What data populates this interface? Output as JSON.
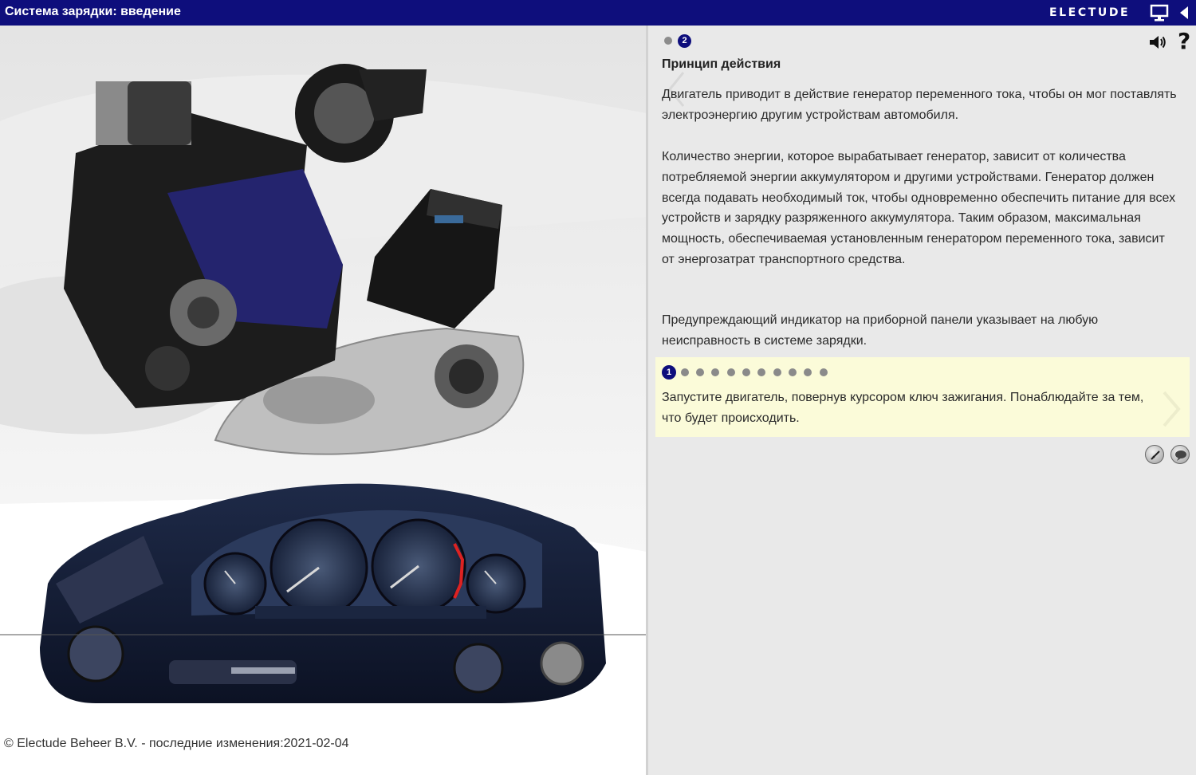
{
  "header": {
    "title": "Система зарядки: введение",
    "brand": "ELECTUDE",
    "screen_icon": "monitor-icon",
    "collapse_icon": "triangle-left-icon"
  },
  "left_pane": {
    "illustration": "car-engine-battery-dashboard-illustration",
    "copyright": "© Electude Beheer B.V. - последние изменения:2021-02-04"
  },
  "right_pane": {
    "page_dots": [
      {
        "label": "",
        "active": false
      },
      {
        "label": "2",
        "active": true
      }
    ],
    "sound_icon": "speaker-icon",
    "help_label": "?",
    "section_title": "Принцип действия",
    "paragraphs": [
      "Двигатель приводит в действие генератор переменного тока, чтобы он мог поставлять электроэнергию другим устройствам автомобиля.",
      "Количество энергии, которое вырабатывает генератор, зависит от количества потребляемой энергии аккумулятором и другими устройствами. Генератор должен всегда подавать необходимый ток, чтобы одновременно обеспечить питание для всех устройств и зарядку разряженного аккумулятора. Таким образом, максимальная мощность, обеспечиваемая установленным генератором переменного тока, зависит от энергозатрат транспортного средства.",
      "Предупреждающий индикатор на приборной панели указывает на любую неисправность в системе зарядки."
    ],
    "task": {
      "current_step_label": "1",
      "step_count": 11,
      "current_step": 1,
      "text": "Запустите двигатель, повернув курсором ключ зажигания. Понаблюдайте за тем, что будет происходить."
    },
    "tools": [
      "compass-icon",
      "speech-bubble-icon"
    ]
  },
  "colors": {
    "header_bg": "#0e0e7c",
    "task_bg": "#fbfbd9",
    "right_bg": "#e9e9e9"
  }
}
